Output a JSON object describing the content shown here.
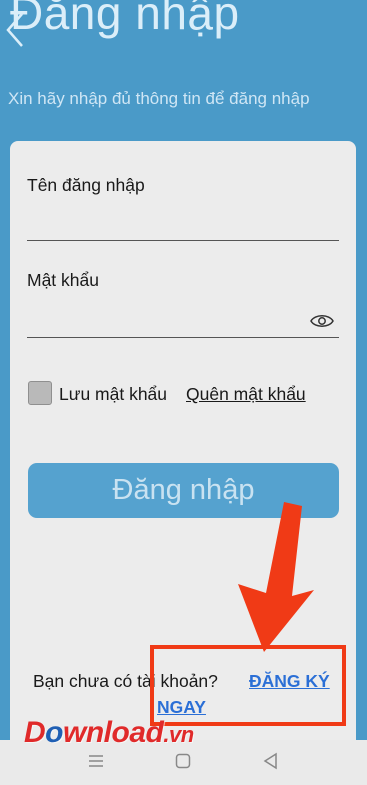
{
  "header": {
    "title": "Đăng nhập",
    "subtitle": "Xin hãy nhập đủ thông tin để đăng nhập"
  },
  "form": {
    "username_label": "Tên đăng nhập",
    "username_value": "",
    "password_label": "Mật khẩu",
    "password_value": "",
    "remember_label": "Lưu mật khẩu",
    "remember_checked": false,
    "forgot_label": "Quên mật khẩu",
    "login_button": "Đăng nhập"
  },
  "signup": {
    "prompt": "Bạn chưa có tài khoản?",
    "link_line1": "ĐĂNG KÝ",
    "link_line2": "NGAY"
  },
  "watermark": {
    "part1": "D",
    "part2": "o",
    "part3": "wnload",
    "suffix": ".vn"
  },
  "icons": {
    "back": "back-arrow-icon",
    "password_toggle": "eye-icon",
    "nav_menu": "menu-icon",
    "nav_home": "home-icon",
    "nav_back": "back-triangle-icon"
  },
  "colors": {
    "background": "#4a9ac8",
    "card": "#ececec",
    "button": "#55a2cf",
    "link": "#2b6fd6",
    "annotation": "#f03a16"
  }
}
